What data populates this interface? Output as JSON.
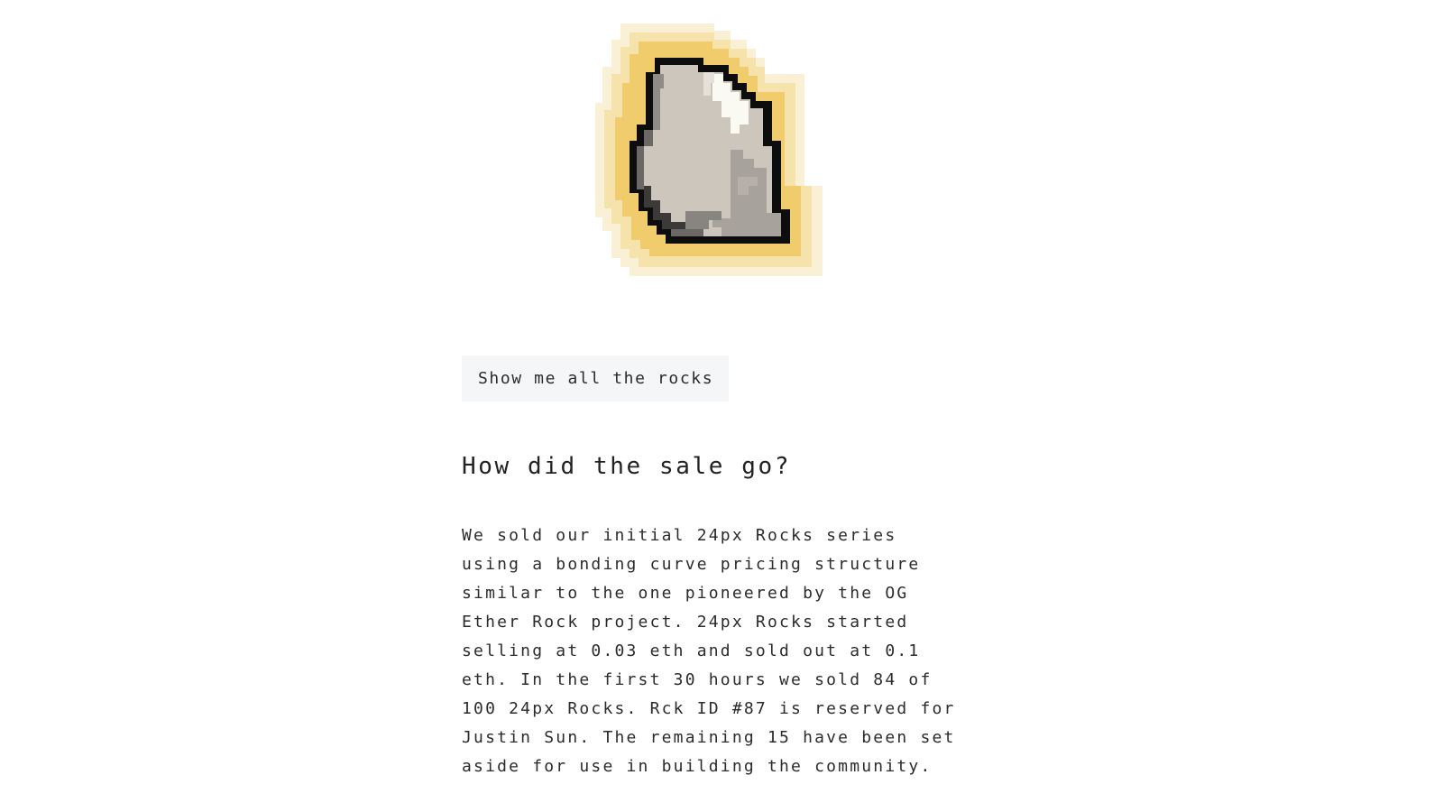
{
  "rock_image": {
    "alt": "24px Rock",
    "icon": "pixel-rock-icon"
  },
  "actions": {
    "show_all_label": "Show me all the rocks"
  },
  "sale_section": {
    "heading": "How did the sale go?",
    "body": "We sold our initial 24px Rocks series using a bonding curve pricing structure similar to the one pioneered by the OG Ether Rock project. 24px Rocks started selling at 0.03 eth and sold out at 0.1 eth. In the first 30 hours we sold 84 of 100 24px Rocks. Rck ID #87 is reserved for Justin Sun. The remaining 15 have been set aside for use in building the community."
  },
  "colors": {
    "glow_outer": "#faf0d6",
    "glow_mid": "#f6e2ab",
    "glow_inner": "#f0cc6c",
    "outline": "#0d0d0d",
    "rock_light": "#cdc6bd",
    "rock_mid": "#a8a29c",
    "rock_dark": "#6b6865",
    "rock_highlight": "#fbfaf2"
  }
}
